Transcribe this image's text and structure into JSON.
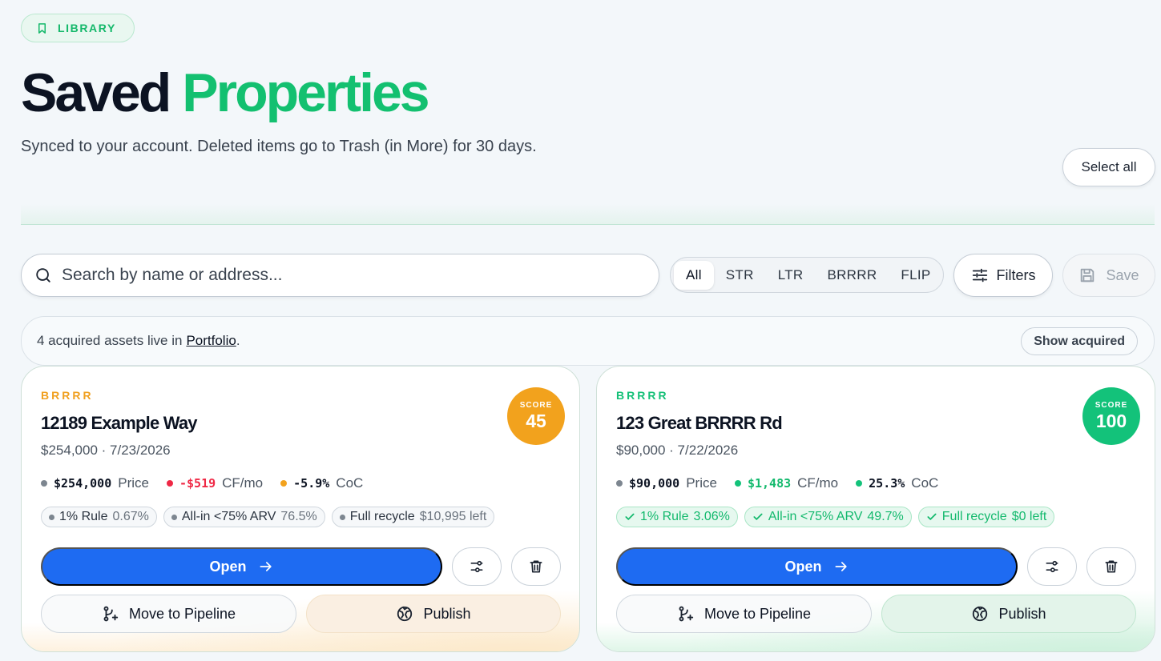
{
  "header": {
    "badge_label": "LIBRARY",
    "title_part1": "Saved",
    "title_part2": "Properties",
    "subtitle": "Synced to your account. Deleted items go to Trash (in More) for 30 days.",
    "select_all_label": "Select all"
  },
  "toolbar": {
    "search_placeholder": "Search by name or address...",
    "segments": [
      "All",
      "STR",
      "LTR",
      "BRRRR",
      "FLIP"
    ],
    "active_segment": "All",
    "filters_label": "Filters",
    "save_label": "Save"
  },
  "info_bar": {
    "text_before": "4 acquired assets live in",
    "link_text": "Portfolio",
    "text_after": ".",
    "show_acquired_label": "Show acquired"
  },
  "colors": {
    "accent_green": "#13c070",
    "primary_blue": "#1e6bf2",
    "score_orange": "#f2a21d",
    "score_green": "#13c27a",
    "negative_red": "#ef2845"
  },
  "cards": [
    {
      "strategy": "BRRRR",
      "address": "12189 Example Way",
      "subline": "$254,000 · 7/23/2026",
      "score_label": "SCORE",
      "score_value": "45",
      "metrics": [
        {
          "value": "$254,000",
          "label": "Price",
          "status": "neutral"
        },
        {
          "value": "-$519",
          "label": "CF/mo",
          "status": "negative"
        },
        {
          "value": "-5.9%",
          "label": "CoC",
          "status": "warning"
        }
      ],
      "chips": [
        {
          "label": "1% Rule",
          "value": "0.67%",
          "status": "neutral"
        },
        {
          "label": "All-in <75% ARV",
          "value": "76.5%",
          "status": "neutral"
        },
        {
          "label": "Full recycle",
          "value": "$10,995 left",
          "status": "neutral"
        }
      ],
      "open_label": "Open",
      "move_label": "Move to Pipeline",
      "publish_label": "Publish"
    },
    {
      "strategy": "BRRRR",
      "address": "123 Great BRRRR Rd",
      "subline": "$90,000 · 7/22/2026",
      "score_label": "SCORE",
      "score_value": "100",
      "metrics": [
        {
          "value": "$90,000",
          "label": "Price",
          "status": "neutral"
        },
        {
          "value": "$1,483",
          "label": "CF/mo",
          "status": "positive"
        },
        {
          "value": "25.3%",
          "label": "CoC",
          "status": "positive"
        }
      ],
      "chips": [
        {
          "label": "1% Rule",
          "value": "3.06%",
          "status": "good"
        },
        {
          "label": "All-in <75% ARV",
          "value": "49.7%",
          "status": "good"
        },
        {
          "label": "Full recycle",
          "value": "$0 left",
          "status": "good"
        }
      ],
      "open_label": "Open",
      "move_label": "Move to Pipeline",
      "publish_label": "Publish"
    }
  ]
}
